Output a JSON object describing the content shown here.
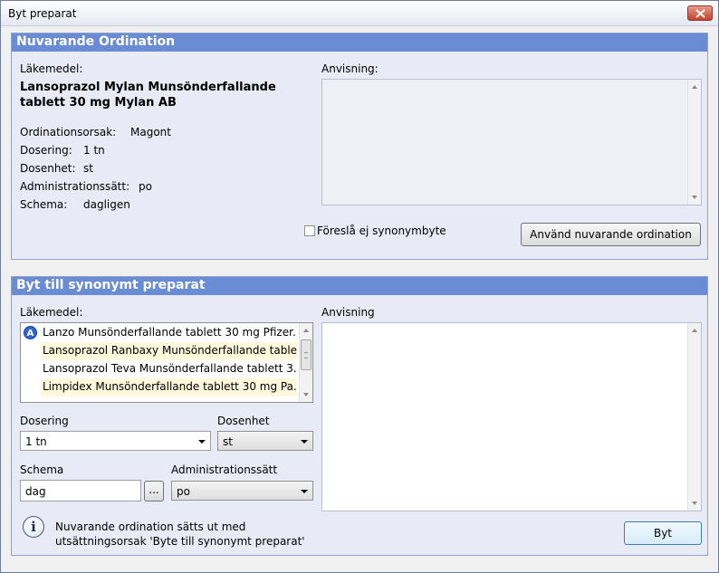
{
  "window": {
    "title": "Byt preparat"
  },
  "current": {
    "header": "Nuvarande Ordination",
    "lakemedel_label": "Läkemedel:",
    "drug_name": "Lansoprazol Mylan Munsönderfallande tablett 30 mg Mylan AB",
    "fields": [
      {
        "label": "Ordinationsorsak:",
        "value": "Magont"
      },
      {
        "label": "Dosering:",
        "value": "1 tn"
      },
      {
        "label": "Dosenhet:",
        "value": "st"
      },
      {
        "label": "Administrationssätt:",
        "value": "po"
      },
      {
        "label": "Schema:",
        "value": "dagligen"
      }
    ],
    "anvisning_label": "Anvisning:",
    "anvisning_value": "",
    "checkbox_label": "Föreslå ej synonymbyte",
    "checkbox_checked": false,
    "use_current_button": "Använd nuvarande ordination"
  },
  "synonym": {
    "header": "Byt till synonymt preparat",
    "lakemedel_label": "Läkemedel:",
    "badge": "A",
    "items": [
      "Lanzo Munsönderfallande tablett 30 mg Pfizer...",
      "Lansoprazol Ranbaxy Munsönderfallande table...",
      "Lansoprazol Teva Munsönderfallande tablett 3...",
      "Limpidex Munsönderfallande tablett 30 mg Pa..."
    ],
    "anvisning_label": "Anvisning",
    "dosering_label": "Dosering",
    "dosering_value": "1 tn",
    "dosenhet_label": "Dosenhet",
    "dosenhet_value": "st",
    "schema_label": "Schema",
    "schema_value": "dag",
    "schema_button": "...",
    "admin_label": "Administrationssätt",
    "admin_value": "po",
    "info_text": "Nuvarande ordination sätts ut med utsättningsorsak 'Byte till synonymt preparat'",
    "byt_button": "Byt"
  },
  "colors": {
    "header_bg": "#6a8cd4",
    "group_bg": "#e8ebf5",
    "alt_row": "#fdf8dc",
    "badge": "#2f64d6"
  },
  "icons": [
    "close-icon",
    "info-icon",
    "scroll-up-icon",
    "scroll-down-icon",
    "dropdown-arrow-icon"
  ]
}
